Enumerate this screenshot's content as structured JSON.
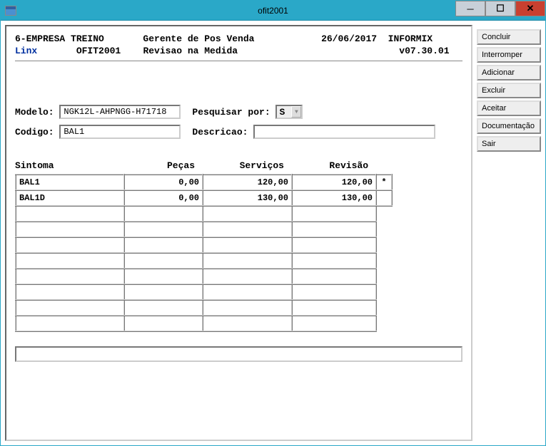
{
  "window": {
    "title": "ofit2001"
  },
  "header": {
    "line1": "6-EMPRESA TREINO       Gerente de Pos Venda            26/06/2017  INFORMIX",
    "linx": "Linx",
    "line2_rest": "       OFIT2001    Revisao na Medida                             v07.30.01"
  },
  "form": {
    "modelo_label": "Modelo: ",
    "modelo_value": "NGK12L-AHPNGG-H71718",
    "pesquisar_label": "Pesquisar por: ",
    "pesquisar_value": "S",
    "codigo_label": "Codigo: ",
    "codigo_value": "BAL1",
    "descricao_label": "Descricao: ",
    "descricao_value": ""
  },
  "table": {
    "headers": {
      "sintoma": "Sintoma",
      "pecas": "Peças",
      "servicos": "Serviços",
      "revisao": "Revisão"
    },
    "rows": [
      {
        "sintoma": "BAL1",
        "pecas": "0,00",
        "servicos": "120,00",
        "revisao": "120,00",
        "extra": "*"
      },
      {
        "sintoma": "BAL1D",
        "pecas": "0,00",
        "servicos": "130,00",
        "revisao": "130,00",
        "extra": ""
      },
      {
        "sintoma": "",
        "pecas": "",
        "servicos": "",
        "revisao": "",
        "extra": ""
      },
      {
        "sintoma": "",
        "pecas": "",
        "servicos": "",
        "revisao": "",
        "extra": ""
      },
      {
        "sintoma": "",
        "pecas": "",
        "servicos": "",
        "revisao": "",
        "extra": ""
      },
      {
        "sintoma": "",
        "pecas": "",
        "servicos": "",
        "revisao": "",
        "extra": ""
      },
      {
        "sintoma": "",
        "pecas": "",
        "servicos": "",
        "revisao": "",
        "extra": ""
      },
      {
        "sintoma": "",
        "pecas": "",
        "servicos": "",
        "revisao": "",
        "extra": ""
      },
      {
        "sintoma": "",
        "pecas": "",
        "servicos": "",
        "revisao": "",
        "extra": ""
      },
      {
        "sintoma": "",
        "pecas": "",
        "servicos": "",
        "revisao": "",
        "extra": ""
      }
    ]
  },
  "buttons": {
    "concluir": "Concluir",
    "interromper": "Interromper",
    "adicionar": "Adicionar",
    "excluir": "Excluir",
    "aceitar": "Aceitar",
    "documentacao": "Documentação",
    "sair": "Sair"
  },
  "status": ""
}
